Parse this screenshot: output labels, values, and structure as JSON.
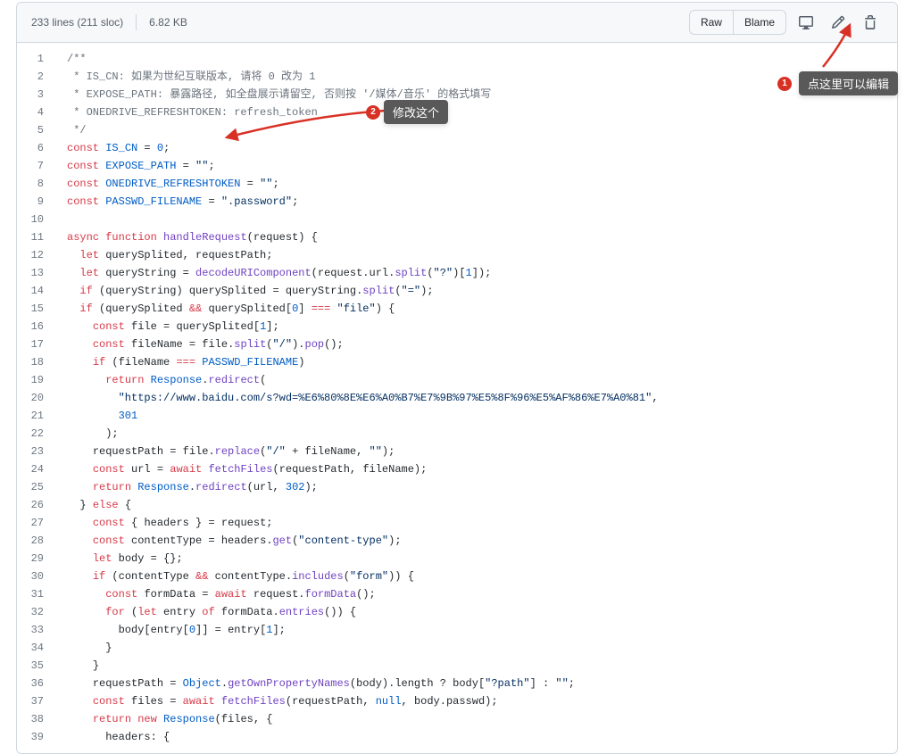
{
  "header": {
    "lines": "233 lines (211 sloc)",
    "size": "6.82 KB",
    "raw": "Raw",
    "blame": "Blame"
  },
  "annotations": {
    "callout1_num": "1",
    "callout1_text": "点这里可以编辑",
    "callout2_num": "2",
    "callout2_text": "修改这个"
  },
  "code": {
    "start_line": 1,
    "lines": [
      [
        [
          "comment",
          "/**"
        ]
      ],
      [
        [
          "comment",
          " * IS_CN: 如果为世纪互联版本, 请将 0 改为 1"
        ]
      ],
      [
        [
          "comment",
          " * EXPOSE_PATH: 暴露路径, 如全盘展示请留空, 否则按 '/媒体/音乐' 的格式填写"
        ]
      ],
      [
        [
          "comment",
          " * ONEDRIVE_REFRESHTOKEN: refresh_token"
        ]
      ],
      [
        [
          "comment",
          " */"
        ]
      ],
      [
        [
          "kw",
          "const"
        ],
        [
          "sp",
          " "
        ],
        [
          "const",
          "IS_CN"
        ],
        [
          "p",
          " = "
        ],
        [
          "num",
          "0"
        ],
        [
          "p",
          ";"
        ]
      ],
      [
        [
          "kw",
          "const"
        ],
        [
          "sp",
          " "
        ],
        [
          "const",
          "EXPOSE_PATH"
        ],
        [
          "p",
          " = "
        ],
        [
          "str",
          "\"\""
        ],
        [
          "p",
          ";"
        ]
      ],
      [
        [
          "kw",
          "const"
        ],
        [
          "sp",
          " "
        ],
        [
          "const",
          "ONEDRIVE_REFRESHTOKEN"
        ],
        [
          "p",
          " = "
        ],
        [
          "str",
          "\"\""
        ],
        [
          "p",
          ";"
        ]
      ],
      [
        [
          "kw",
          "const"
        ],
        [
          "sp",
          " "
        ],
        [
          "const",
          "PASSWD_FILENAME"
        ],
        [
          "p",
          " = "
        ],
        [
          "str",
          "\".password\""
        ],
        [
          "p",
          ";"
        ]
      ],
      [],
      [
        [
          "kw",
          "async"
        ],
        [
          "sp",
          " "
        ],
        [
          "kw",
          "function"
        ],
        [
          "sp",
          " "
        ],
        [
          "fn",
          "handleRequest"
        ],
        [
          "p",
          "("
        ],
        [
          "prop",
          "request"
        ],
        [
          "p",
          ") {"
        ]
      ],
      [
        [
          "sp",
          "  "
        ],
        [
          "kw",
          "let"
        ],
        [
          "sp",
          " "
        ],
        [
          "prop",
          "querySplited"
        ],
        [
          "p",
          ", "
        ],
        [
          "prop",
          "requestPath"
        ],
        [
          "p",
          ";"
        ]
      ],
      [
        [
          "sp",
          "  "
        ],
        [
          "kw",
          "let"
        ],
        [
          "sp",
          " "
        ],
        [
          "prop",
          "queryString"
        ],
        [
          "p",
          " = "
        ],
        [
          "fn",
          "decodeURIComponent"
        ],
        [
          "p",
          "("
        ],
        [
          "prop",
          "request"
        ],
        [
          "p",
          "."
        ],
        [
          "prop",
          "url"
        ],
        [
          "p",
          "."
        ],
        [
          "fn",
          "split"
        ],
        [
          "p",
          "("
        ],
        [
          "str",
          "\"?\""
        ],
        [
          "p",
          ")["
        ],
        [
          "num",
          "1"
        ],
        [
          "p",
          "]);"
        ]
      ],
      [
        [
          "sp",
          "  "
        ],
        [
          "kw",
          "if"
        ],
        [
          "p",
          " ("
        ],
        [
          "prop",
          "queryString"
        ],
        [
          "p",
          ") "
        ],
        [
          "prop",
          "querySplited"
        ],
        [
          "p",
          " = "
        ],
        [
          "prop",
          "queryString"
        ],
        [
          "p",
          "."
        ],
        [
          "fn",
          "split"
        ],
        [
          "p",
          "("
        ],
        [
          "str",
          "\"=\""
        ],
        [
          "p",
          ");"
        ]
      ],
      [
        [
          "sp",
          "  "
        ],
        [
          "kw",
          "if"
        ],
        [
          "p",
          " ("
        ],
        [
          "prop",
          "querySplited"
        ],
        [
          "p",
          " "
        ],
        [
          "kw",
          "&&"
        ],
        [
          "p",
          " "
        ],
        [
          "prop",
          "querySplited"
        ],
        [
          "p",
          "["
        ],
        [
          "num",
          "0"
        ],
        [
          "p",
          "] "
        ],
        [
          "kw",
          "==="
        ],
        [
          "p",
          " "
        ],
        [
          "str",
          "\"file\""
        ],
        [
          "p",
          ") {"
        ]
      ],
      [
        [
          "sp",
          "    "
        ],
        [
          "kw",
          "const"
        ],
        [
          "sp",
          " "
        ],
        [
          "prop",
          "file"
        ],
        [
          "p",
          " = "
        ],
        [
          "prop",
          "querySplited"
        ],
        [
          "p",
          "["
        ],
        [
          "num",
          "1"
        ],
        [
          "p",
          "];"
        ]
      ],
      [
        [
          "sp",
          "    "
        ],
        [
          "kw",
          "const"
        ],
        [
          "sp",
          " "
        ],
        [
          "prop",
          "fileName"
        ],
        [
          "p",
          " = "
        ],
        [
          "prop",
          "file"
        ],
        [
          "p",
          "."
        ],
        [
          "fn",
          "split"
        ],
        [
          "p",
          "("
        ],
        [
          "str",
          "\"/\""
        ],
        [
          "p",
          ")."
        ],
        [
          "fn",
          "pop"
        ],
        [
          "p",
          "();"
        ]
      ],
      [
        [
          "sp",
          "    "
        ],
        [
          "kw",
          "if"
        ],
        [
          "p",
          " ("
        ],
        [
          "prop",
          "fileName"
        ],
        [
          "p",
          " "
        ],
        [
          "kw",
          "==="
        ],
        [
          "p",
          " "
        ],
        [
          "const",
          "PASSWD_FILENAME"
        ],
        [
          "p",
          ")"
        ]
      ],
      [
        [
          "sp",
          "      "
        ],
        [
          "kw",
          "return"
        ],
        [
          "sp",
          " "
        ],
        [
          "const",
          "Response"
        ],
        [
          "p",
          "."
        ],
        [
          "fn",
          "redirect"
        ],
        [
          "p",
          "("
        ]
      ],
      [
        [
          "sp",
          "        "
        ],
        [
          "str",
          "\"https://www.baidu.com/s?wd=%E6%80%8E%E6%A0%B7%E7%9B%97%E5%8F%96%E5%AF%86%E7%A0%81\""
        ],
        [
          "p",
          ","
        ]
      ],
      [
        [
          "sp",
          "        "
        ],
        [
          "num",
          "301"
        ]
      ],
      [
        [
          "sp",
          "      "
        ],
        [
          "p",
          ");"
        ]
      ],
      [
        [
          "sp",
          "    "
        ],
        [
          "prop",
          "requestPath"
        ],
        [
          "p",
          " = "
        ],
        [
          "prop",
          "file"
        ],
        [
          "p",
          "."
        ],
        [
          "fn",
          "replace"
        ],
        [
          "p",
          "("
        ],
        [
          "str",
          "\"/\""
        ],
        [
          "p",
          " + "
        ],
        [
          "prop",
          "fileName"
        ],
        [
          "p",
          ", "
        ],
        [
          "str",
          "\"\""
        ],
        [
          "p",
          ");"
        ]
      ],
      [
        [
          "sp",
          "    "
        ],
        [
          "kw",
          "const"
        ],
        [
          "sp",
          " "
        ],
        [
          "prop",
          "url"
        ],
        [
          "p",
          " = "
        ],
        [
          "kw",
          "await"
        ],
        [
          "sp",
          " "
        ],
        [
          "fn",
          "fetchFiles"
        ],
        [
          "p",
          "("
        ],
        [
          "prop",
          "requestPath"
        ],
        [
          "p",
          ", "
        ],
        [
          "prop",
          "fileName"
        ],
        [
          "p",
          ");"
        ]
      ],
      [
        [
          "sp",
          "    "
        ],
        [
          "kw",
          "return"
        ],
        [
          "sp",
          " "
        ],
        [
          "const",
          "Response"
        ],
        [
          "p",
          "."
        ],
        [
          "fn",
          "redirect"
        ],
        [
          "p",
          "("
        ],
        [
          "prop",
          "url"
        ],
        [
          "p",
          ", "
        ],
        [
          "num",
          "302"
        ],
        [
          "p",
          ");"
        ]
      ],
      [
        [
          "sp",
          "  "
        ],
        [
          "p",
          "} "
        ],
        [
          "kw",
          "else"
        ],
        [
          "p",
          " {"
        ]
      ],
      [
        [
          "sp",
          "    "
        ],
        [
          "kw",
          "const"
        ],
        [
          "p",
          " { "
        ],
        [
          "prop",
          "headers"
        ],
        [
          "p",
          " } = "
        ],
        [
          "prop",
          "request"
        ],
        [
          "p",
          ";"
        ]
      ],
      [
        [
          "sp",
          "    "
        ],
        [
          "kw",
          "const"
        ],
        [
          "sp",
          " "
        ],
        [
          "prop",
          "contentType"
        ],
        [
          "p",
          " = "
        ],
        [
          "prop",
          "headers"
        ],
        [
          "p",
          "."
        ],
        [
          "fn",
          "get"
        ],
        [
          "p",
          "("
        ],
        [
          "str",
          "\"content-type\""
        ],
        [
          "p",
          ");"
        ]
      ],
      [
        [
          "sp",
          "    "
        ],
        [
          "kw",
          "let"
        ],
        [
          "sp",
          " "
        ],
        [
          "prop",
          "body"
        ],
        [
          "p",
          " = {};"
        ]
      ],
      [
        [
          "sp",
          "    "
        ],
        [
          "kw",
          "if"
        ],
        [
          "p",
          " ("
        ],
        [
          "prop",
          "contentType"
        ],
        [
          "p",
          " "
        ],
        [
          "kw",
          "&&"
        ],
        [
          "p",
          " "
        ],
        [
          "prop",
          "contentType"
        ],
        [
          "p",
          "."
        ],
        [
          "fn",
          "includes"
        ],
        [
          "p",
          "("
        ],
        [
          "str",
          "\"form\""
        ],
        [
          "p",
          ")) {"
        ]
      ],
      [
        [
          "sp",
          "      "
        ],
        [
          "kw",
          "const"
        ],
        [
          "sp",
          " "
        ],
        [
          "prop",
          "formData"
        ],
        [
          "p",
          " = "
        ],
        [
          "kw",
          "await"
        ],
        [
          "sp",
          " "
        ],
        [
          "prop",
          "request"
        ],
        [
          "p",
          "."
        ],
        [
          "fn",
          "formData"
        ],
        [
          "p",
          "();"
        ]
      ],
      [
        [
          "sp",
          "      "
        ],
        [
          "kw",
          "for"
        ],
        [
          "p",
          " ("
        ],
        [
          "kw",
          "let"
        ],
        [
          "sp",
          " "
        ],
        [
          "prop",
          "entry"
        ],
        [
          "p",
          " "
        ],
        [
          "kw",
          "of"
        ],
        [
          "p",
          " "
        ],
        [
          "prop",
          "formData"
        ],
        [
          "p",
          "."
        ],
        [
          "fn",
          "entries"
        ],
        [
          "p",
          "()) {"
        ]
      ],
      [
        [
          "sp",
          "        "
        ],
        [
          "prop",
          "body"
        ],
        [
          "p",
          "["
        ],
        [
          "prop",
          "entry"
        ],
        [
          "p",
          "["
        ],
        [
          "num",
          "0"
        ],
        [
          "p",
          "]] = "
        ],
        [
          "prop",
          "entry"
        ],
        [
          "p",
          "["
        ],
        [
          "num",
          "1"
        ],
        [
          "p",
          "];"
        ]
      ],
      [
        [
          "sp",
          "      "
        ],
        [
          "p",
          "}"
        ]
      ],
      [
        [
          "sp",
          "    "
        ],
        [
          "p",
          "}"
        ]
      ],
      [
        [
          "sp",
          "    "
        ],
        [
          "prop",
          "requestPath"
        ],
        [
          "p",
          " = "
        ],
        [
          "const",
          "Object"
        ],
        [
          "p",
          "."
        ],
        [
          "fn",
          "getOwnPropertyNames"
        ],
        [
          "p",
          "("
        ],
        [
          "prop",
          "body"
        ],
        [
          "p",
          ")."
        ],
        [
          "prop",
          "length"
        ],
        [
          "p",
          " ? "
        ],
        [
          "prop",
          "body"
        ],
        [
          "p",
          "["
        ],
        [
          "str",
          "\"?path\""
        ],
        [
          "p",
          "] : "
        ],
        [
          "str",
          "\"\""
        ],
        [
          "p",
          ";"
        ]
      ],
      [
        [
          "sp",
          "    "
        ],
        [
          "kw",
          "const"
        ],
        [
          "sp",
          " "
        ],
        [
          "prop",
          "files"
        ],
        [
          "p",
          " = "
        ],
        [
          "kw",
          "await"
        ],
        [
          "sp",
          " "
        ],
        [
          "fn",
          "fetchFiles"
        ],
        [
          "p",
          "("
        ],
        [
          "prop",
          "requestPath"
        ],
        [
          "p",
          ", "
        ],
        [
          "num",
          "null"
        ],
        [
          "p",
          ", "
        ],
        [
          "prop",
          "body"
        ],
        [
          "p",
          "."
        ],
        [
          "prop",
          "passwd"
        ],
        [
          "p",
          ");"
        ]
      ],
      [
        [
          "sp",
          "    "
        ],
        [
          "kw",
          "return"
        ],
        [
          "sp",
          " "
        ],
        [
          "kw",
          "new"
        ],
        [
          "sp",
          " "
        ],
        [
          "const",
          "Response"
        ],
        [
          "p",
          "("
        ],
        [
          "prop",
          "files"
        ],
        [
          "p",
          ", {"
        ]
      ],
      [
        [
          "sp",
          "      "
        ],
        [
          "prop",
          "headers"
        ],
        [
          "p",
          ": {"
        ]
      ]
    ]
  }
}
